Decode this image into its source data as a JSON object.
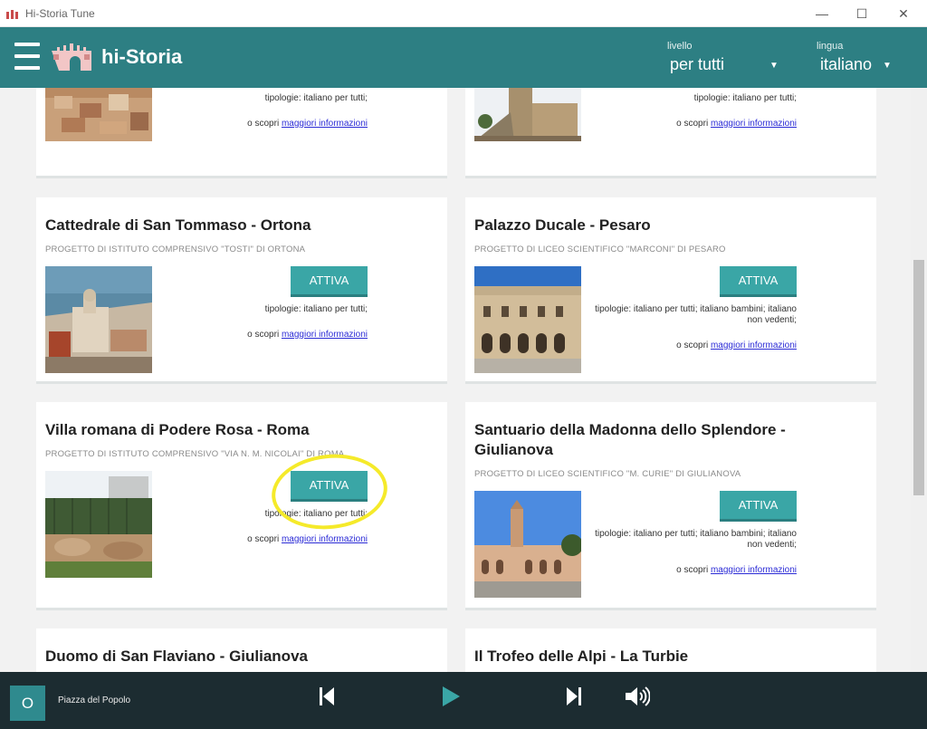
{
  "window": {
    "title": "Hi-Storia Tune",
    "minimize": "—",
    "maximize": "☐",
    "close": "✕"
  },
  "header": {
    "logo_text": "hi-Storia",
    "level": {
      "label": "livello",
      "value": "per tutti"
    },
    "language": {
      "label": "lingua",
      "value": "italiano"
    }
  },
  "labels": {
    "activate": "ATTIVA",
    "types_prefix": "tipologie:",
    "more_prefix": "o scopri",
    "more_link": "maggiori informazioni"
  },
  "cards": [
    {
      "title": "",
      "subtitle": "",
      "types": "italiano per tutti;"
    },
    {
      "title": "",
      "subtitle": "",
      "types": "italiano per tutti;"
    },
    {
      "title": "Cattedrale di San Tommaso - Ortona",
      "subtitle": "PROGETTO DI ISTITUTO COMPRENSIVO \"TOSTI\" DI ORTONA",
      "types": "italiano per tutti;"
    },
    {
      "title": "Palazzo Ducale - Pesaro",
      "subtitle": "PROGETTO DI LICEO SCIENTIFICO \"MARCONI\" DI PESARO",
      "types": "italiano per tutti; italiano bambini; italiano non vedenti;"
    },
    {
      "title": "Villa romana di Podere Rosa - Roma",
      "subtitle": "PROGETTO DI ISTITUTO COMPRENSIVO \"VIA N. M. NICOLAI\" DI ROMA",
      "types": "italiano per tutti;"
    },
    {
      "title": "Santuario della Madonna dello Splendore - Giulianova",
      "subtitle": "PROGETTO DI LICEO SCIENTIFICO \"M. CURIE\" DI GIULIANOVA",
      "types": "italiano per tutti; italiano bambini; italiano non vedenti;"
    },
    {
      "title": "Duomo di San Flaviano - Giulianova"
    },
    {
      "title": "Il Trofeo delle Alpi - La Turbie"
    }
  ],
  "player": {
    "avatar_letter": "O",
    "track": "Piazza del Popolo"
  },
  "colors": {
    "header": "#2d7f83",
    "button": "#3aa6a6",
    "player": "#1c2c31",
    "play_icon": "#3aa6a6",
    "highlight": "#f5ea2a"
  }
}
